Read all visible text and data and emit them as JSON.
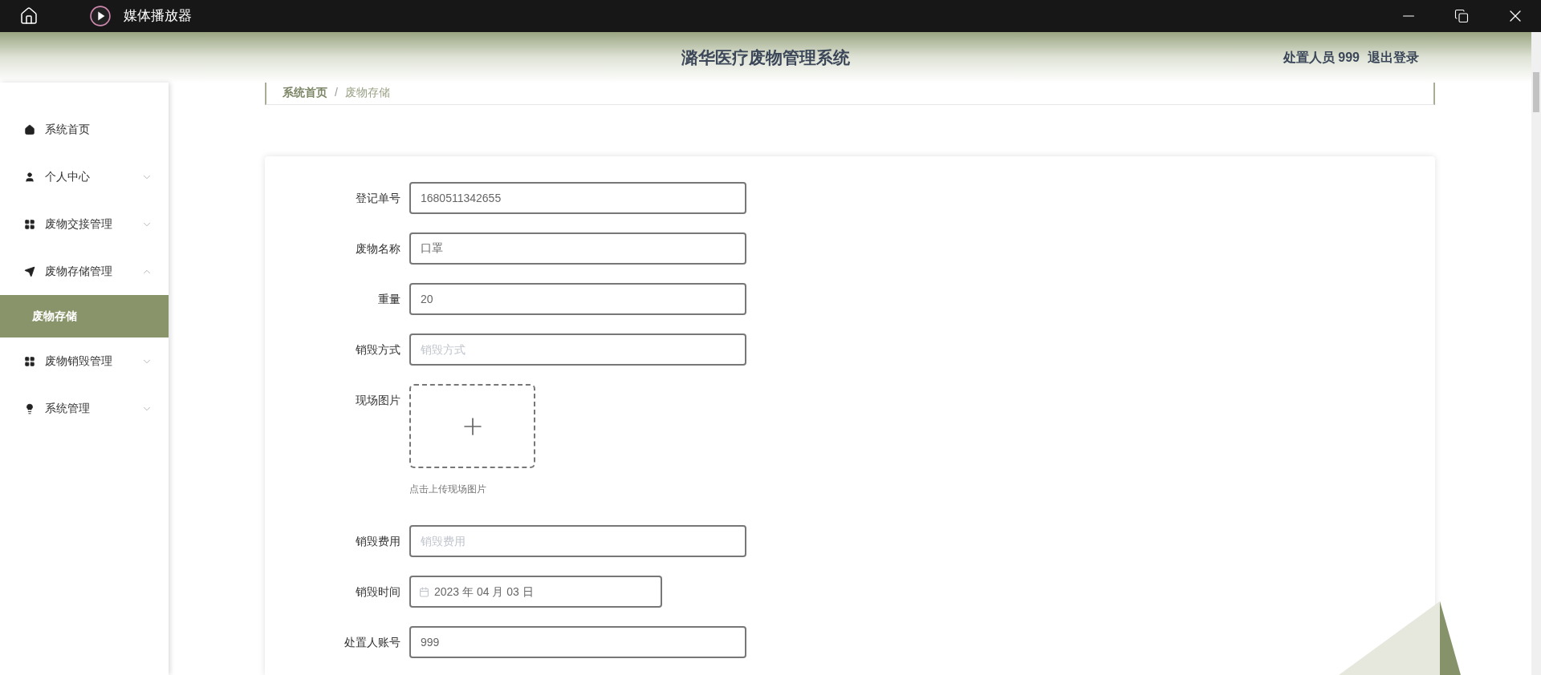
{
  "window": {
    "title": "媒体播放器"
  },
  "header": {
    "title": "潞华医疗废物管理系统",
    "user": "处置人员 999",
    "logout": "退出登录"
  },
  "sidebar": {
    "items": [
      {
        "label": "系统首页"
      },
      {
        "label": "个人中心",
        "expanded": false
      },
      {
        "label": "废物交接管理",
        "expanded": false
      },
      {
        "label": "废物存储管理",
        "expanded": true,
        "children": [
          {
            "label": "废物存储",
            "selected": true
          }
        ]
      },
      {
        "label": "废物销毁管理",
        "expanded": false
      },
      {
        "label": "系统管理",
        "expanded": false
      }
    ]
  },
  "breadcrumb": {
    "items": [
      "系统首页",
      "废物存储"
    ],
    "separator": "/"
  },
  "form": {
    "fields": [
      {
        "kind": "text",
        "label": "登记单号",
        "value": "1680511342655"
      },
      {
        "kind": "text",
        "label": "废物名称",
        "value": "口罩"
      },
      {
        "kind": "text",
        "label": "重量",
        "value": "20"
      },
      {
        "kind": "text",
        "label": "销毁方式",
        "placeholder": "销毁方式"
      },
      {
        "kind": "upload",
        "label": "现场图片",
        "hint": "点击上传现场图片"
      },
      {
        "kind": "text",
        "label": "销毁费用",
        "placeholder": "销毁费用"
      },
      {
        "kind": "date",
        "label": "销毁时间",
        "value": "2023 年 04 月 03 日"
      },
      {
        "kind": "text",
        "label": "处置人账号",
        "value": "999"
      }
    ]
  }
}
